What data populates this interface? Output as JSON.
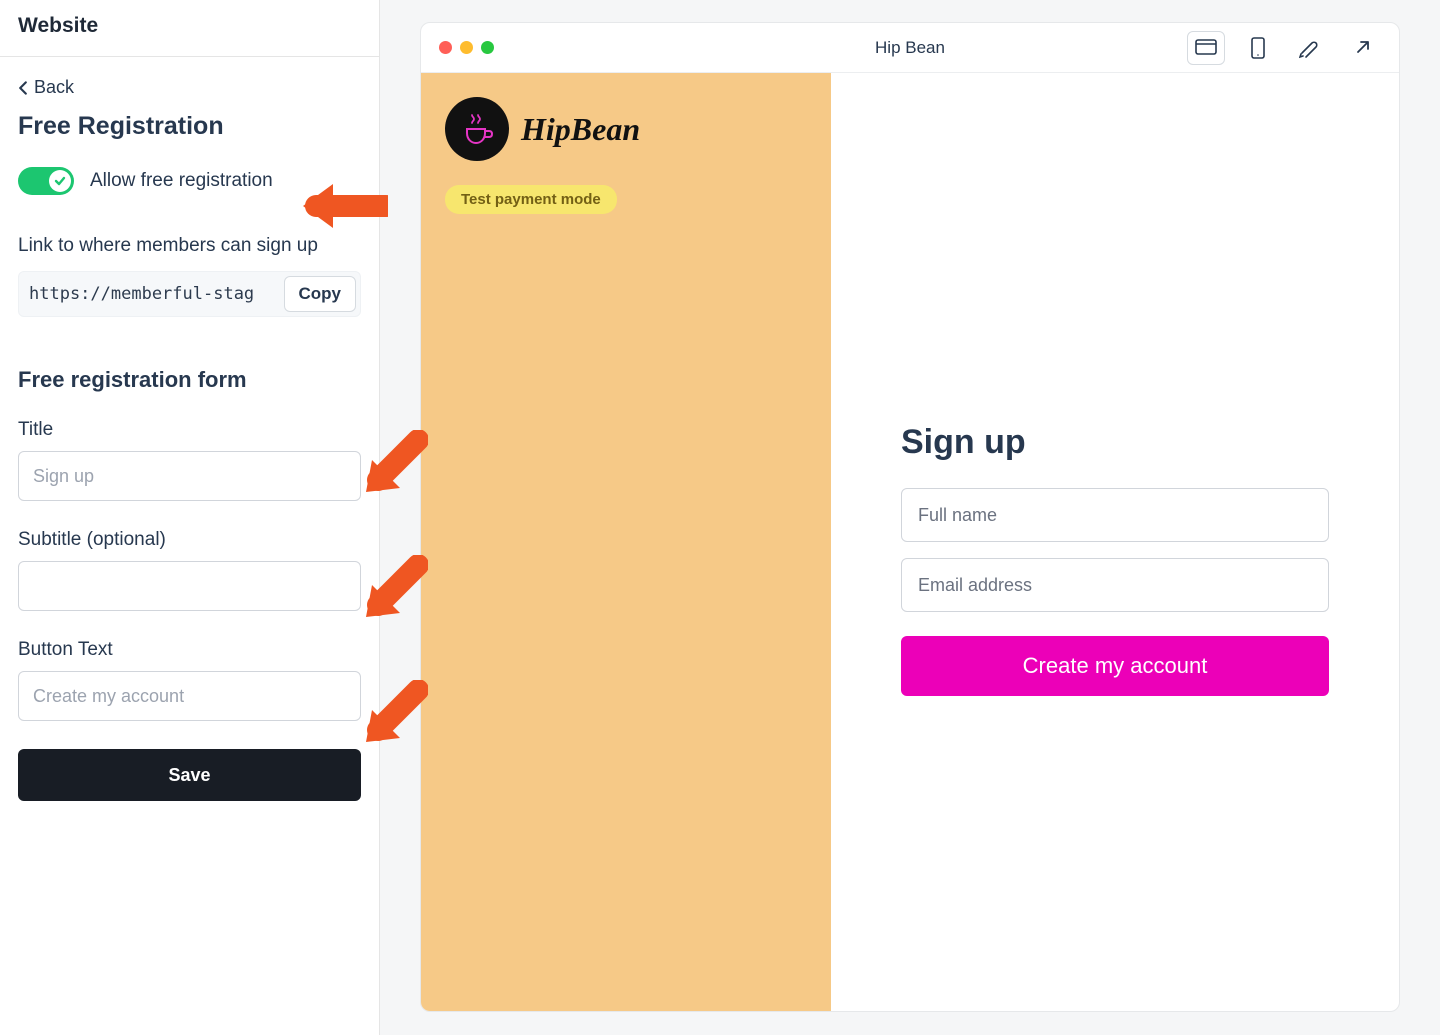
{
  "sidebar": {
    "header": "Website",
    "back_label": "Back",
    "page_title": "Free Registration",
    "toggle_label": "Allow free registration",
    "link_label": "Link to where members can sign up",
    "link_value": "https://memberful-stag",
    "copy_label": "Copy",
    "form_section_heading": "Free registration form",
    "title_label": "Title",
    "title_placeholder": "Sign up",
    "subtitle_label": "Subtitle (optional)",
    "button_text_label": "Button Text",
    "button_text_placeholder": "Create my account",
    "save_label": "Save"
  },
  "preview": {
    "browser_title": "Hip Bean",
    "brand_name": "HipBean",
    "payment_badge": "Test payment mode",
    "form_heading": "Sign up",
    "fullname_placeholder": "Full name",
    "email_placeholder": "Email address",
    "submit_label": "Create my account"
  },
  "colors": {
    "toggle_on": "#1cc670",
    "arrow": "#ef5622",
    "brand_panel": "#f6c987",
    "badge_bg": "#f7e66e",
    "primary_button": "#ec00b8"
  }
}
